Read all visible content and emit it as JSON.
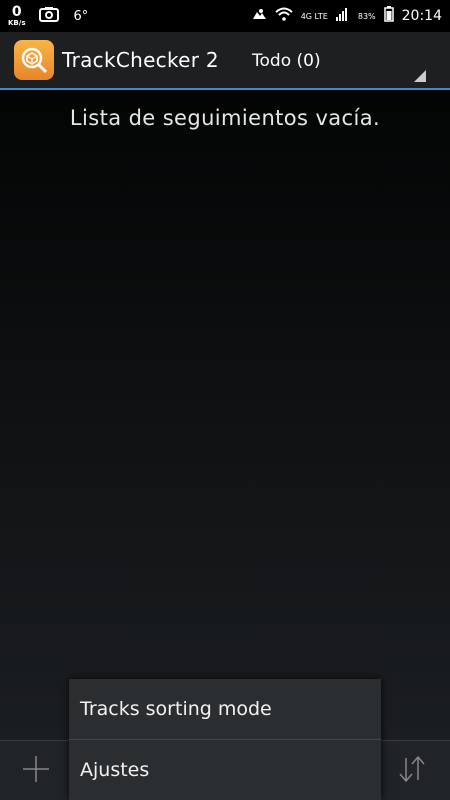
{
  "status_bar": {
    "net_speed_value": "0",
    "net_speed_unit": "KB/s",
    "temperature": "6°",
    "network_type": "4G LTE",
    "battery_percent": "83%",
    "time": "20:14",
    "icons": [
      "screenshot-icon",
      "cloud-icon",
      "wifi-icon",
      "signal-icon",
      "battery-icon"
    ]
  },
  "action_bar": {
    "app_title": "TrackChecker 2",
    "filter_label": "Todo (0)",
    "accent_color": "#3a8ec4",
    "app_icon": "package-magnifier-icon"
  },
  "main": {
    "empty_message": "Lista de seguimientos vacía."
  },
  "bottom_bar": {
    "icons": [
      "add-icon",
      "sort-icon"
    ]
  },
  "popup_menu": {
    "items": [
      {
        "label": "Tracks sorting mode"
      },
      {
        "label": "Ajustes"
      }
    ]
  }
}
